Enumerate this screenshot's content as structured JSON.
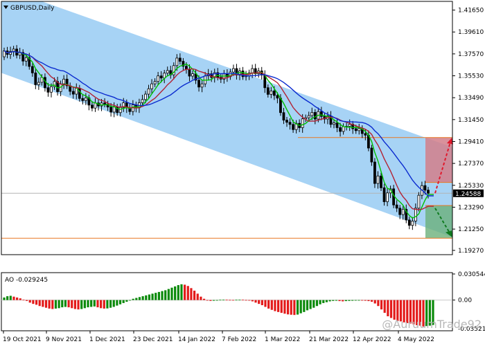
{
  "chart_data": {
    "type": "candlestick",
    "title": "GBPUSD,Daily",
    "symbol": "GBPUSD",
    "timeframe": "Daily",
    "price_axis": {
      "ticks": [
        "1.41650",
        "1.39610",
        "1.37570",
        "1.35530",
        "1.33490",
        "1.31450",
        "1.29410",
        "1.27370",
        "1.25330",
        "1.23290",
        "1.21250",
        "1.19270"
      ],
      "ylim": [
        1.1887,
        1.4246
      ]
    },
    "current_price": "1.24588",
    "x_ticks": [
      "19 Oct 2021",
      "9 Nov 2021",
      "1 Dec 2021",
      "23 Dec 2021",
      "14 Jan 2022",
      "7 Feb 2022",
      "1 Mar 2022",
      "21 Mar 2022",
      "12 Apr 2022",
      "4 May 2022"
    ],
    "closes": [
      1.3785,
      1.3752,
      1.378,
      1.3802,
      1.3745,
      1.377,
      1.369,
      1.3722,
      1.364,
      1.358,
      1.347,
      1.3492,
      1.3538,
      1.3442,
      1.34,
      1.3452,
      1.35,
      1.3405,
      1.3478,
      1.3522,
      1.346,
      1.3408,
      1.3382,
      1.3438,
      1.3342,
      1.3322,
      1.3348,
      1.328,
      1.3252,
      1.33,
      1.3272,
      1.33,
      1.329,
      1.3262,
      1.3215,
      1.3262,
      1.321,
      1.3258,
      1.3302,
      1.3255,
      1.322,
      1.3282,
      1.3255,
      1.3302,
      1.3332,
      1.3382,
      1.3432,
      1.3478,
      1.35,
      1.3552,
      1.3532,
      1.3578,
      1.3602,
      1.3562,
      1.3648,
      1.3718,
      1.3688,
      1.3642,
      1.3615,
      1.355,
      1.3572,
      1.3512,
      1.3448,
      1.3478,
      1.3552,
      1.3572,
      1.3538,
      1.3582,
      1.354,
      1.3522,
      1.357,
      1.3545,
      1.3588,
      1.362,
      1.356,
      1.3598,
      1.3545,
      1.3555,
      1.358,
      1.362,
      1.3572,
      1.3598,
      1.356,
      1.3442,
      1.338,
      1.3412,
      1.337,
      1.3345,
      1.321,
      1.314,
      1.312,
      1.31,
      1.3052,
      1.311,
      1.307,
      1.3152,
      1.3162,
      1.3182,
      1.3212,
      1.315,
      1.322,
      1.3175,
      1.315,
      1.318,
      1.31,
      1.3115,
      1.307,
      1.3035,
      1.308,
      1.3082,
      1.3102,
      1.306,
      1.3042,
      1.3062,
      1.3015,
      1.3,
      1.288,
      1.275,
      1.255,
      1.262,
      1.251,
      1.238,
      1.2462,
      1.25,
      1.235,
      1.232,
      1.226,
      1.231,
      1.221,
      1.216,
      1.22,
      1.232,
      1.244,
      1.253,
      1.2488,
      1.2459
    ],
    "moving_averages": [
      {
        "color": "#00c000",
        "closes_ma": 5
      },
      {
        "color": "#b22234",
        "closes_ma": 10
      },
      {
        "color": "#0b2bcf",
        "closes_ma": 20
      }
    ],
    "levels": {
      "resistance": 1.2978,
      "support": 1.204,
      "mid_box_top": 1.256,
      "mid_box_bottom": 1.2345
    },
    "indicator": {
      "name": "AO",
      "label": "AO -0.029245",
      "value": "-0.029245",
      "ticks": [
        "0.030544",
        "0.00"
      ],
      "bottom_label": "-0.035219",
      "ylim": [
        -0.0352,
        0.0305
      ],
      "bars": [
        0.003,
        0.0045,
        0.005,
        0.004,
        0.003,
        0.002,
        0.0005,
        -0.001,
        -0.003,
        -0.0045,
        -0.0055,
        -0.007,
        -0.008,
        -0.009,
        -0.01,
        -0.0105,
        -0.01,
        -0.0095,
        -0.0085,
        -0.008,
        -0.0085,
        -0.0095,
        -0.0105,
        -0.011,
        -0.0105,
        -0.0095,
        -0.0085,
        -0.008,
        -0.0075,
        -0.0085,
        -0.0095,
        -0.01,
        -0.0098,
        -0.009,
        -0.008,
        -0.0065,
        -0.005,
        -0.0035,
        -0.002,
        0.0,
        0.0015,
        0.0025,
        0.0035,
        0.0045,
        0.0055,
        0.0065,
        0.0075,
        0.0085,
        0.0095,
        0.0105,
        0.0115,
        0.013,
        0.0145,
        0.016,
        0.0175,
        0.0185,
        0.018,
        0.0165,
        0.014,
        0.011,
        0.0075,
        0.004,
        0.0015,
        -0.0005,
        -0.001,
        -0.0008,
        -0.0002,
        0.0003,
        0.0005,
        0.0004,
        0.0002,
        0.0001,
        0.0003,
        0.0005,
        0.0004,
        0.0001,
        -0.0005,
        -0.0015,
        -0.003,
        -0.0045,
        -0.006,
        -0.008,
        -0.01,
        -0.0115,
        -0.013,
        -0.014,
        -0.015,
        -0.016,
        -0.0168,
        -0.0172,
        -0.0175,
        -0.017,
        -0.0155,
        -0.014,
        -0.012,
        -0.0105,
        -0.009,
        -0.007,
        -0.005,
        -0.0035,
        -0.0025,
        -0.0015,
        -0.001,
        -0.0008,
        -0.0012,
        -0.0015,
        -0.0012,
        -0.001,
        -0.0008,
        -0.0006,
        -0.0005,
        -0.0006,
        -0.0008,
        -0.0012,
        -0.002,
        -0.004,
        -0.007,
        -0.011,
        -0.015,
        -0.019,
        -0.021,
        -0.023,
        -0.0245,
        -0.025,
        -0.0262,
        -0.027,
        -0.0275,
        -0.0285,
        -0.0295,
        -0.03,
        -0.031,
        -0.0305,
        -0.03,
        -0.0292
      ]
    },
    "bull_color": "#000000",
    "bear_color": "#000000",
    "ao_up_color": "#0a8a0a",
    "ao_down_color": "#e31a1a",
    "channel_color": "#a7d3f5",
    "level_color": "#e87722"
  },
  "watermark": "@AuruumTrade92"
}
